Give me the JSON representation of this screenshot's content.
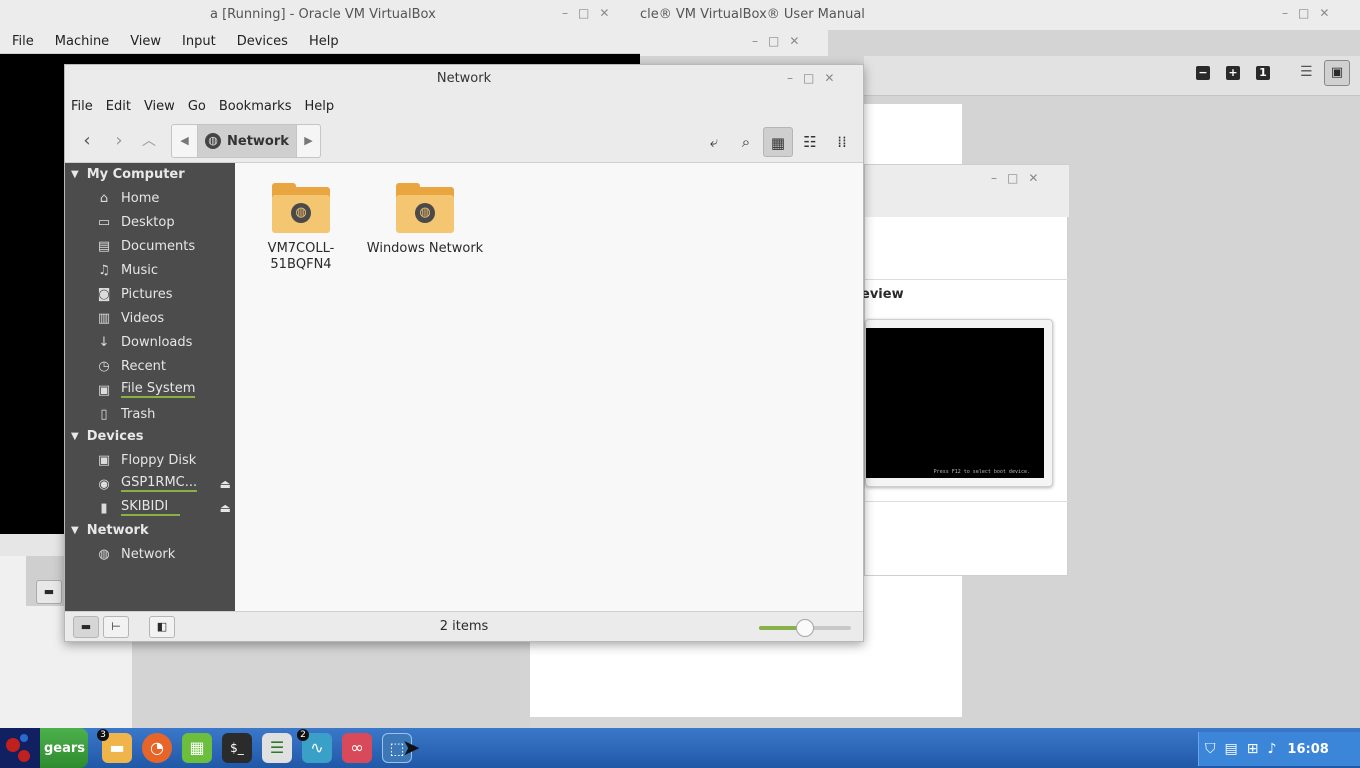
{
  "manual_window": {
    "title": "Oracle® VM VirtualBox® User Manual",
    "title_visible": "cle® VM VirtualBox® User Manual",
    "toolbar": [
      "minus-icon",
      "plus-icon",
      "one-icon",
      "sidebar-icon",
      "single-page-icon"
    ]
  },
  "vm_window": {
    "title": "a [Running] - Oracle VM VirtualBox",
    "menu": [
      "File",
      "Machine",
      "View",
      "Input",
      "Devices",
      "Help"
    ]
  },
  "preview_dialog": {
    "heading_visible": "eview",
    "screen_text": "Press F12 to select boot device."
  },
  "file_manager": {
    "title": "Network",
    "menu": [
      "File",
      "Edit",
      "View",
      "Go",
      "Bookmarks",
      "Help"
    ],
    "pathbar": {
      "current": "Network"
    },
    "sidebar": {
      "sections": [
        {
          "label": "My Computer",
          "items": [
            {
              "label": "Home",
              "icon": "home-icon"
            },
            {
              "label": "Desktop",
              "icon": "desktop-icon"
            },
            {
              "label": "Documents",
              "icon": "documents-icon"
            },
            {
              "label": "Music",
              "icon": "music-icon"
            },
            {
              "label": "Pictures",
              "icon": "pictures-icon"
            },
            {
              "label": "Videos",
              "icon": "videos-icon"
            },
            {
              "label": "Downloads",
              "icon": "downloads-icon"
            },
            {
              "label": "Recent",
              "icon": "recent-icon"
            },
            {
              "label": "File System",
              "icon": "filesystem-icon"
            },
            {
              "label": "Trash",
              "icon": "trash-icon"
            }
          ]
        },
        {
          "label": "Devices",
          "items": [
            {
              "label": "Floppy Disk",
              "icon": "floppy-icon"
            },
            {
              "label": "GSP1RMC...",
              "icon": "disc-icon"
            },
            {
              "label": "SKIBIDI",
              "icon": "usb-icon"
            }
          ]
        },
        {
          "label": "Network",
          "items": [
            {
              "label": "Network",
              "icon": "network-icon"
            }
          ]
        }
      ]
    },
    "items": [
      {
        "label": "VM7COLL-51BQFN4",
        "label_line1": "VM7COLL-",
        "label_line2": "51BQFN4"
      },
      {
        "label": "Windows Network"
      }
    ],
    "status": "2 items",
    "zoom_level": 0.5
  },
  "taskbar": {
    "start_label": "gears",
    "apps": [
      {
        "name": "files",
        "badge": "3"
      },
      {
        "name": "firefox"
      },
      {
        "name": "calculator"
      },
      {
        "name": "terminal"
      },
      {
        "name": "settings"
      },
      {
        "name": "system-monitor",
        "badge": "2"
      },
      {
        "name": "glasses-app"
      },
      {
        "name": "virtualbox"
      }
    ],
    "clock": "16:08"
  },
  "colors": {
    "accent": "#8ab04a",
    "folder": "#f5c671",
    "sidebar": "#4c4c4c",
    "taskbar": "#2a64b4"
  }
}
